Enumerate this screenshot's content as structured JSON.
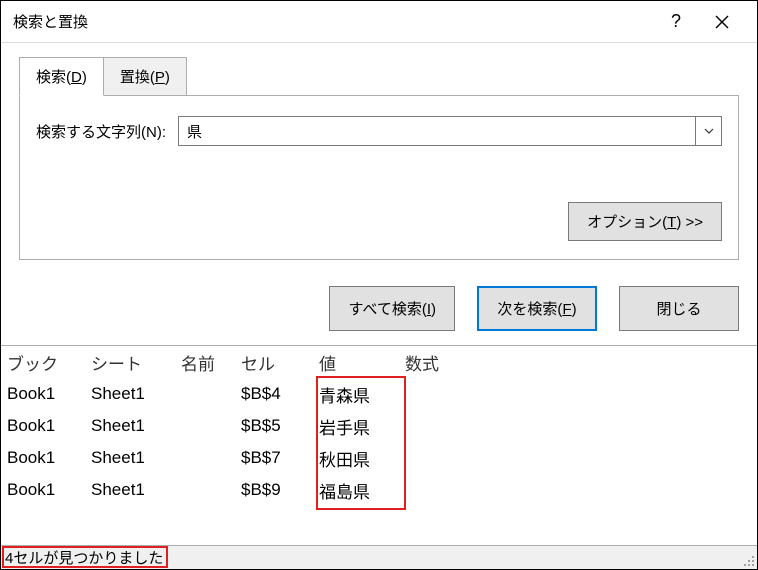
{
  "title": "検索と置換",
  "help_icon": "?",
  "tabs": {
    "find": {
      "label": "検索(",
      "accel": "D",
      "suffix": ")"
    },
    "replace": {
      "label": "置換(",
      "accel": "P",
      "suffix": ")"
    }
  },
  "form": {
    "search_label": "検索する文字列(",
    "search_accel": "N",
    "search_suffix": "):",
    "search_value": "県"
  },
  "options_btn": {
    "label": "オプション(",
    "accel": "T",
    "suffix": ") >>"
  },
  "actions": {
    "find_all": {
      "label": "すべて検索(",
      "accel": "I",
      "suffix": ")"
    },
    "find_next": {
      "label": "次を検索(",
      "accel": "F",
      "suffix": ")"
    },
    "close": {
      "label": "閉じる"
    }
  },
  "columns": {
    "book": "ブック",
    "sheet": "シート",
    "name": "名前",
    "cell": "セル",
    "value": "値",
    "formula": "数式"
  },
  "rows": [
    {
      "book": "Book1",
      "sheet": "Sheet1",
      "name": "",
      "cell": "$B$4",
      "value": "青森県",
      "formula": ""
    },
    {
      "book": "Book1",
      "sheet": "Sheet1",
      "name": "",
      "cell": "$B$5",
      "value": "岩手県",
      "formula": ""
    },
    {
      "book": "Book1",
      "sheet": "Sheet1",
      "name": "",
      "cell": "$B$7",
      "value": "秋田県",
      "formula": ""
    },
    {
      "book": "Book1",
      "sheet": "Sheet1",
      "name": "",
      "cell": "$B$9",
      "value": "福島県",
      "formula": ""
    }
  ],
  "status": "4セルが見つかりました"
}
